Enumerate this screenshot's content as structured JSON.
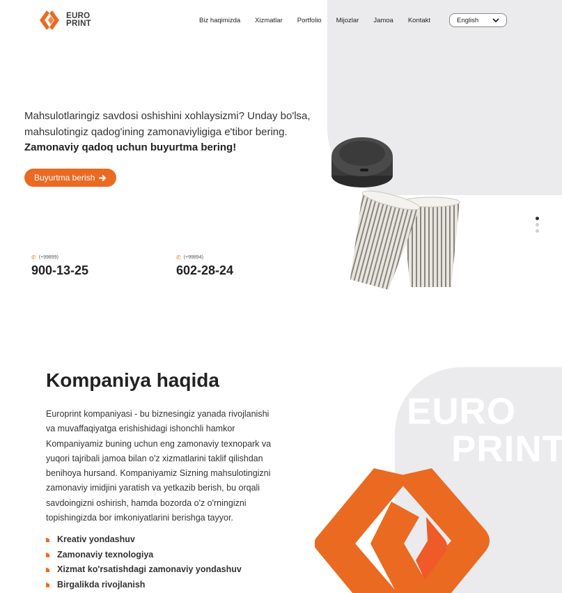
{
  "header": {
    "logo_line1": "EURO",
    "logo_line2": "PRINT",
    "nav": [
      "Biz haqimizda",
      "Xizmatlar",
      "Portfolio",
      "Mijozlar",
      "Jamoa",
      "Kontakt"
    ],
    "language": "English"
  },
  "hero": {
    "text": "Mahsulotlaringiz savdosi oshishini xohlaysizmi? Unday bo'lsa, mahsulotingiz qadog'ining zamonaviyligiga e'tibor bering.",
    "bold_text": "Zamonaviy qadoq uchun buyurtma bering!",
    "button": "Buyurtma berish",
    "phones": [
      {
        "code": "(+99899)",
        "number": "900-13-25"
      },
      {
        "code": "(+99894)",
        "number": "602-28-24"
      }
    ]
  },
  "about": {
    "title": "Kompaniya haqida",
    "text": "Europrint kompaniyasi - bu biznesingiz yanada rivojlanishi va muvaffaqiyatga erishishidagi ishonchli hamkor Kompaniyamiz buning uchun eng zamonaviy texnopark va yuqori tajribali jamoa bilan o'z xizmatlarini taklif qilishdan benihoya hursand. Kompaniyamiz Sizning mahsulotingizni zamonaviy imidjini yaratish va yetkazib berish, bu orqali savdoingizni oshirish, hamda bozorda o'z o'rningizni topishingizda bor imkoniyatlarini berishga tayyor.",
    "features": [
      "Kreativ yondashuv",
      "Zamonaviy texnologiya",
      "Xizmat ko'rsatishdagi zamonaviy yondashuv",
      "Birgalikda rivojlanish"
    ],
    "watermark_line1": "EURO",
    "watermark_line2": "PRINT"
  },
  "colors": {
    "accent": "#ea6a22",
    "panel": "#ebebed"
  },
  "icons": [
    "logo-icon",
    "phone-icon",
    "arrow-right-icon",
    "chevron-down-icon"
  ]
}
